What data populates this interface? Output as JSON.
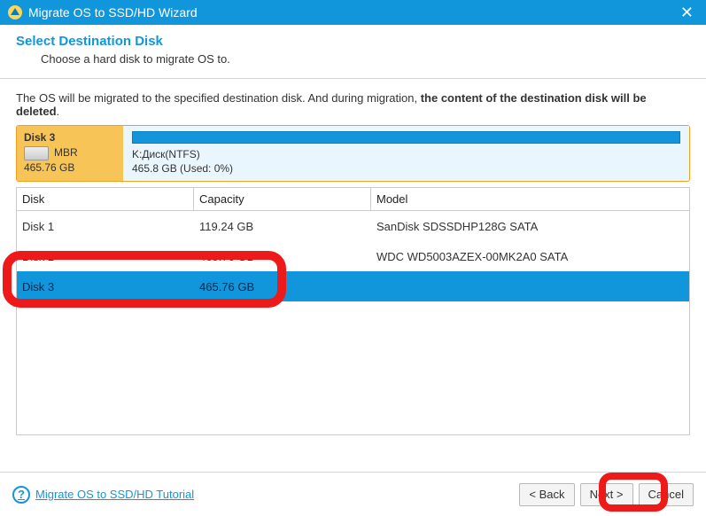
{
  "titlebar": {
    "title": "Migrate OS to SSD/HD Wizard"
  },
  "header": {
    "title": "Select Destination Disk",
    "subtitle": "Choose a hard disk to migrate OS to."
  },
  "notice": {
    "text_a": "The OS will be migrated to the specified destination disk. And during migration, ",
    "text_b": "the content of the destination disk will be deleted",
    "text_c": "."
  },
  "selected_disk": {
    "name": "Disk 3",
    "scheme": "MBR",
    "size": "465.76 GB",
    "partition_label": "K:Диск(NTFS)",
    "partition_usage": "465.8 GB (Used: 0%)"
  },
  "columns": {
    "disk": "Disk",
    "capacity": "Capacity",
    "model": "Model"
  },
  "rows": [
    {
      "disk": "Disk 1",
      "capacity": "119.24 GB",
      "model": "SanDisk SDSSDHP128G SATA",
      "selected": false
    },
    {
      "disk": "Disk 2",
      "capacity": "465.76 GB",
      "model": "WDC WD5003AZEX-00MK2A0 SATA",
      "selected": false
    },
    {
      "disk": "Disk 3",
      "capacity": "465.76 GB",
      "model": "",
      "selected": true
    }
  ],
  "footer": {
    "help_label": "Migrate OS to SSD/HD Tutorial",
    "back": "< Back",
    "next": "Next >",
    "cancel": "Cancel"
  }
}
